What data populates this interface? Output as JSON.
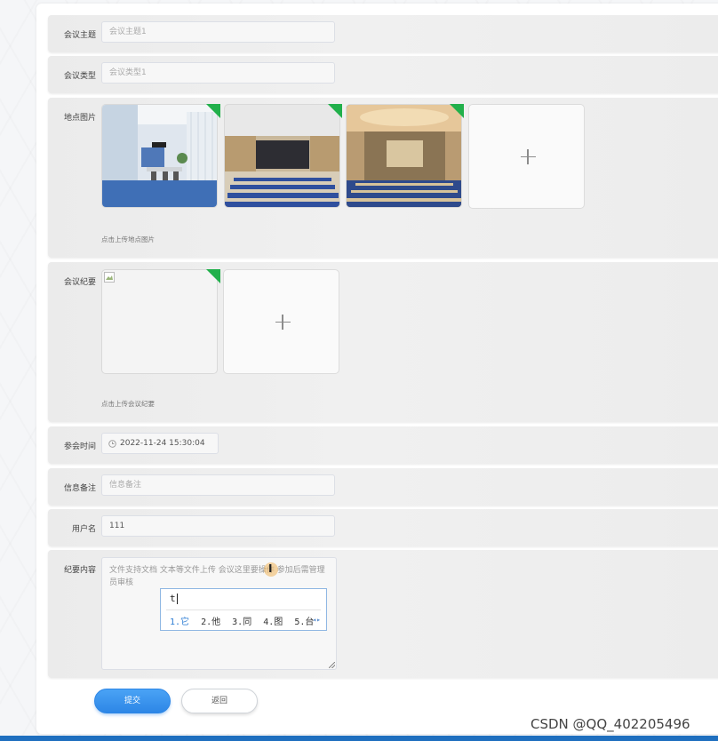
{
  "form": {
    "topic": {
      "label": "会议主题",
      "placeholder": "会议主题1"
    },
    "type": {
      "label": "会议类型",
      "placeholder": "会议类型1"
    },
    "venue_images": {
      "label": "地点图片",
      "images": [
        "meeting-room-photo",
        "auditorium-photo",
        "banquet-hall-photo"
      ],
      "hint": "点击上传地点图片"
    },
    "minutes_file": {
      "label": "会议纪要",
      "hint": "点击上传会议纪要"
    },
    "attend_time": {
      "label": "参会时间",
      "value": "2022-11-24 15:30:04",
      "icon": "clock-icon"
    },
    "remark": {
      "label": "信息备注",
      "placeholder": "信息备注"
    },
    "username": {
      "label": "用户名",
      "value": "111"
    },
    "content": {
      "label": "纪要内容",
      "placeholder": "文件支持文档 文本等文件上传 会议这里要操作 参加后需管理员审核"
    }
  },
  "ime": {
    "composition": "t",
    "candidates": [
      "1.它",
      "2.他",
      "3.同",
      "4.图",
      "5.台"
    ]
  },
  "buttons": {
    "submit": "提交",
    "back": "返回"
  },
  "watermark": "CSDN @QQ_402205496",
  "colors": {
    "accent": "#2d86e6",
    "upload_mark": "#21b04b"
  }
}
